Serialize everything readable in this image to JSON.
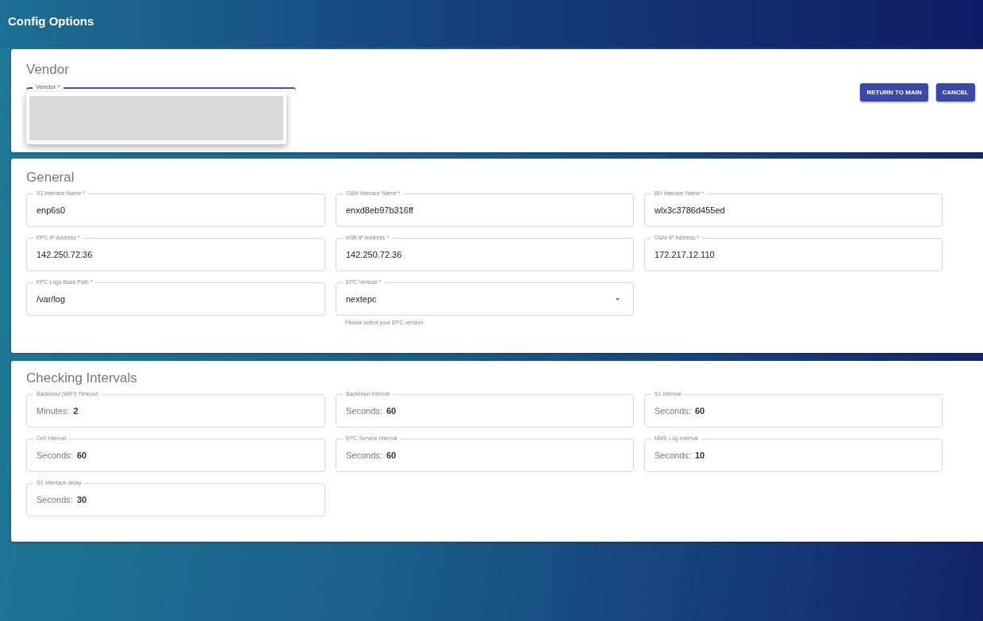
{
  "window": {
    "title": "Config Options"
  },
  "vendor": {
    "heading": "Vendor",
    "field": {
      "label": "Vendor *",
      "focused": true,
      "menu_open": true
    },
    "buttons": [
      "RETURN TO MAIN",
      "CANCEL"
    ]
  },
  "general": {
    "heading": "General",
    "fields": [
      {
        "kind": "text",
        "label": "S1 Interace Name *",
        "value": "enp6s0"
      },
      {
        "kind": "text",
        "label": "O&M Interace Name *",
        "value": "enxd8eb97b316ff"
      },
      {
        "kind": "text",
        "label": "BH Interace Name *",
        "value": "wlx3c3786d455ed"
      },
      {
        "kind": "text",
        "label": "EPC IP Address *",
        "value": "142.250.72.36"
      },
      {
        "kind": "text",
        "label": "eNB IP Address *",
        "value": "142.250.72.36"
      },
      {
        "kind": "text",
        "label": "O&M IP Address *",
        "value": "172.217.12.110"
      },
      {
        "kind": "text",
        "label": "EPC Logs Base Path *",
        "value": "/var/log"
      },
      {
        "kind": "select",
        "label": "EPC Version *",
        "value": "nextepc",
        "helper": "Please select your EPC version"
      }
    ]
  },
  "intervals": {
    "heading": "Checking Intervals",
    "fields": [
      {
        "label": "BackHaul (WiFi) Timeout",
        "unit": "Minutes:",
        "value": "2"
      },
      {
        "label": "BackHaul Interval",
        "unit": "Seconds:",
        "value": "60"
      },
      {
        "label": "S1 Interval",
        "unit": "Seconds:",
        "value": "60"
      },
      {
        "label": "Cell Interval",
        "unit": "Seconds:",
        "value": "60"
      },
      {
        "label": "EPC Service Interval",
        "unit": "Seconds:",
        "value": "60"
      },
      {
        "label": "MME Log Interval",
        "unit": "Seconds:",
        "value": "10"
      },
      {
        "label": "S1 Interface delay",
        "unit": "Seconds:",
        "value": "30"
      }
    ]
  }
}
